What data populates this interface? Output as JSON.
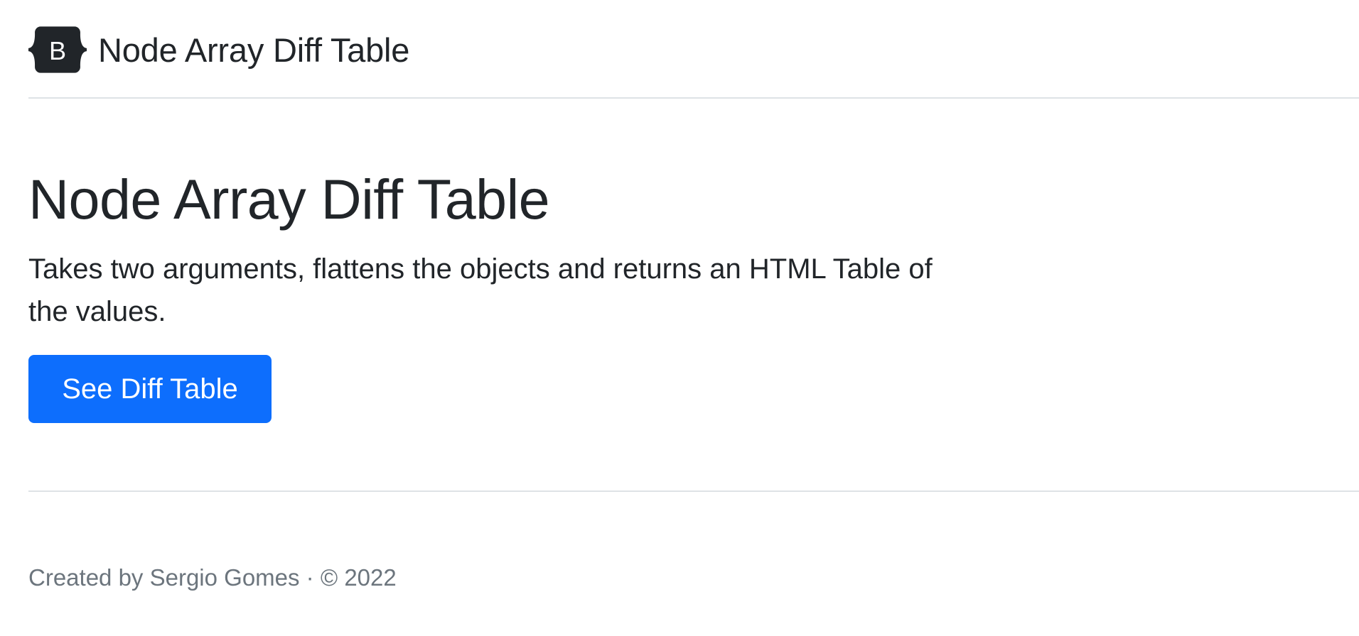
{
  "header": {
    "brand_icon": "bootstrap-logo-icon",
    "brand_icon_letter": "B",
    "brand_text": "Node Array Diff Table"
  },
  "hero": {
    "title": "Node Array Diff Table",
    "lead": "Takes two arguments, flattens the objects and returns an HTML Table of the values.",
    "button_label": "See Diff Table"
  },
  "footer": {
    "text": "Created by Sergio Gomes · © 2022"
  },
  "colors": {
    "primary": "#0d6efd",
    "text": "#212529",
    "muted": "#6c757d",
    "border": "#dee2e6",
    "logo_bg": "#212529"
  }
}
